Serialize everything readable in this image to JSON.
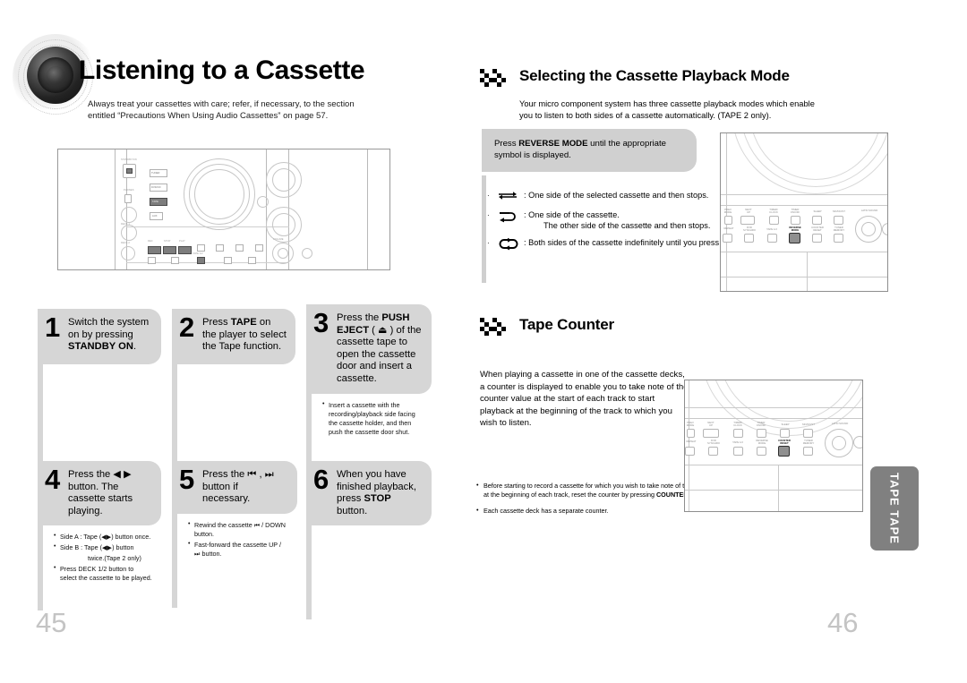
{
  "left_page": {
    "title": "Listening to a Cassette",
    "subtitle": "Always treat your cassettes with care; refer, if necessary, to the section entitled “Precautions When Using Audio Cassettes” on page 57.",
    "page_number": "45",
    "steps": [
      {
        "number": "1",
        "text_plain": "Switch the system on by pressing ",
        "text_bold": "STANDBY ON",
        "text_tail": ".",
        "notes": []
      },
      {
        "number": "2",
        "text_plain": "Press ",
        "text_bold": "TAPE",
        "text_tail": " on the player to select the Tape function.",
        "notes": []
      },
      {
        "number": "3",
        "text_plain": "Press the ",
        "text_bold": "PUSH EJECT",
        "text_tail": " ( ⏏ ) of the cassette tape to open the cassette door and insert a cassette.",
        "notes": [
          "Insert a cassette with the recording/playback side facing the cassette holder, and then push the cassette door shut."
        ]
      },
      {
        "number": "4",
        "text_plain": "Press the ◀ ▶ button. The cassette starts playing.",
        "text_bold": "",
        "text_tail": "",
        "notes": [
          "Side A : Tape (◀▶) button once.",
          "Side B : Tape (◀▶) button",
          "twice.(Tape 2 only)",
          "Press DECK 1/2 button to select the cassette to be played."
        ]
      },
      {
        "number": "5",
        "text_plain": "Press the ⏮ , ⏭ button if necessary.",
        "text_bold": "",
        "text_tail": "",
        "notes": [
          "Rewind the cassette ⏮ / DOWN button.",
          "Fast-forward the cassette UP / ⏭ button."
        ]
      },
      {
        "number": "6",
        "text_plain": "When you have finished playback, press ",
        "text_bold": "STOP",
        "text_tail": " button.",
        "notes": []
      }
    ],
    "device_labels": {
      "power": "POWER",
      "tuner": "TUNER",
      "dvd": "DVD/CD",
      "tape": "TAPE",
      "aux": "AUX",
      "phones": "PHONES",
      "deck1": "DECK 1",
      "deck2": "DECK 2",
      "volume": "VOLUME"
    }
  },
  "right_page": {
    "page_number": "46",
    "section1": {
      "title": "Selecting the Cassette Playback Mode",
      "subtitle": "Your micro component system has three cassette playback modes which enable you to listen to both sides of a cassette automatically. (TAPE 2 only).",
      "callout_plain_before": "Press ",
      "callout_bold": "REVERSE MODE",
      "callout_plain_after": " until the appropriate symbol is displayed.",
      "modes": [
        {
          "symbol": "reverse-mode-single-icon",
          "desc": ": One side of the selected cassette and then stops.",
          "desc2": ""
        },
        {
          "symbol": "reverse-mode-both-icon",
          "desc": ": One side of the cassette.",
          "desc2": "The other side of the cassette and then stops."
        },
        {
          "symbol": "reverse-mode-loop-icon",
          "desc": ": Both sides of the cassette indefinitely until you press stop.",
          "desc2": ""
        }
      ]
    },
    "section2": {
      "title": "Tape Counter",
      "body": "When playing a cassette in one of the cassette decks, a counter is displayed to enable you to take note of the counter value at the start of each track to start playback at the beginning of the track to which you wish to listen.",
      "notes": [
        {
          "before": "Before starting to record a cassette for which you wish to take note of the counter values at the beginning of each track, reset the counter by pressing ",
          "bold": "COUNTER RESET",
          "after": " ."
        },
        {
          "before": "Each cassette deck has a separate counter.",
          "bold": "",
          "after": ""
        }
      ]
    },
    "panel_labels": {
      "prev_mode": "PREV\nMODE",
      "next_up": "NEXT\nUP",
      "timer_clock": "TIMER/\nCLOCK",
      "timer_onoff": "TIMER\nON/OFF",
      "sleep": "SLEEP",
      "mo_st": "MO/NO/ST",
      "repeat": "REPEAT",
      "dvd_sync": "DVD\nSYNCHRO",
      "tape12": "TAPE 1/2",
      "reverse_mode": "REVERSE\nMODE",
      "counter_reset": "COUNTER\nRESET",
      "tuner_memory": "TUNER\nMEMORY",
      "latin_sound": "LATIN SOUND"
    }
  },
  "side_tab": {
    "label": "TAPE TAPE"
  },
  "colors": {
    "step_gray": "#d6d6d6",
    "callout_gray": "#d0d0d0",
    "tab_gray": "#808080",
    "pageno_gray": "#c4c4c4"
  }
}
